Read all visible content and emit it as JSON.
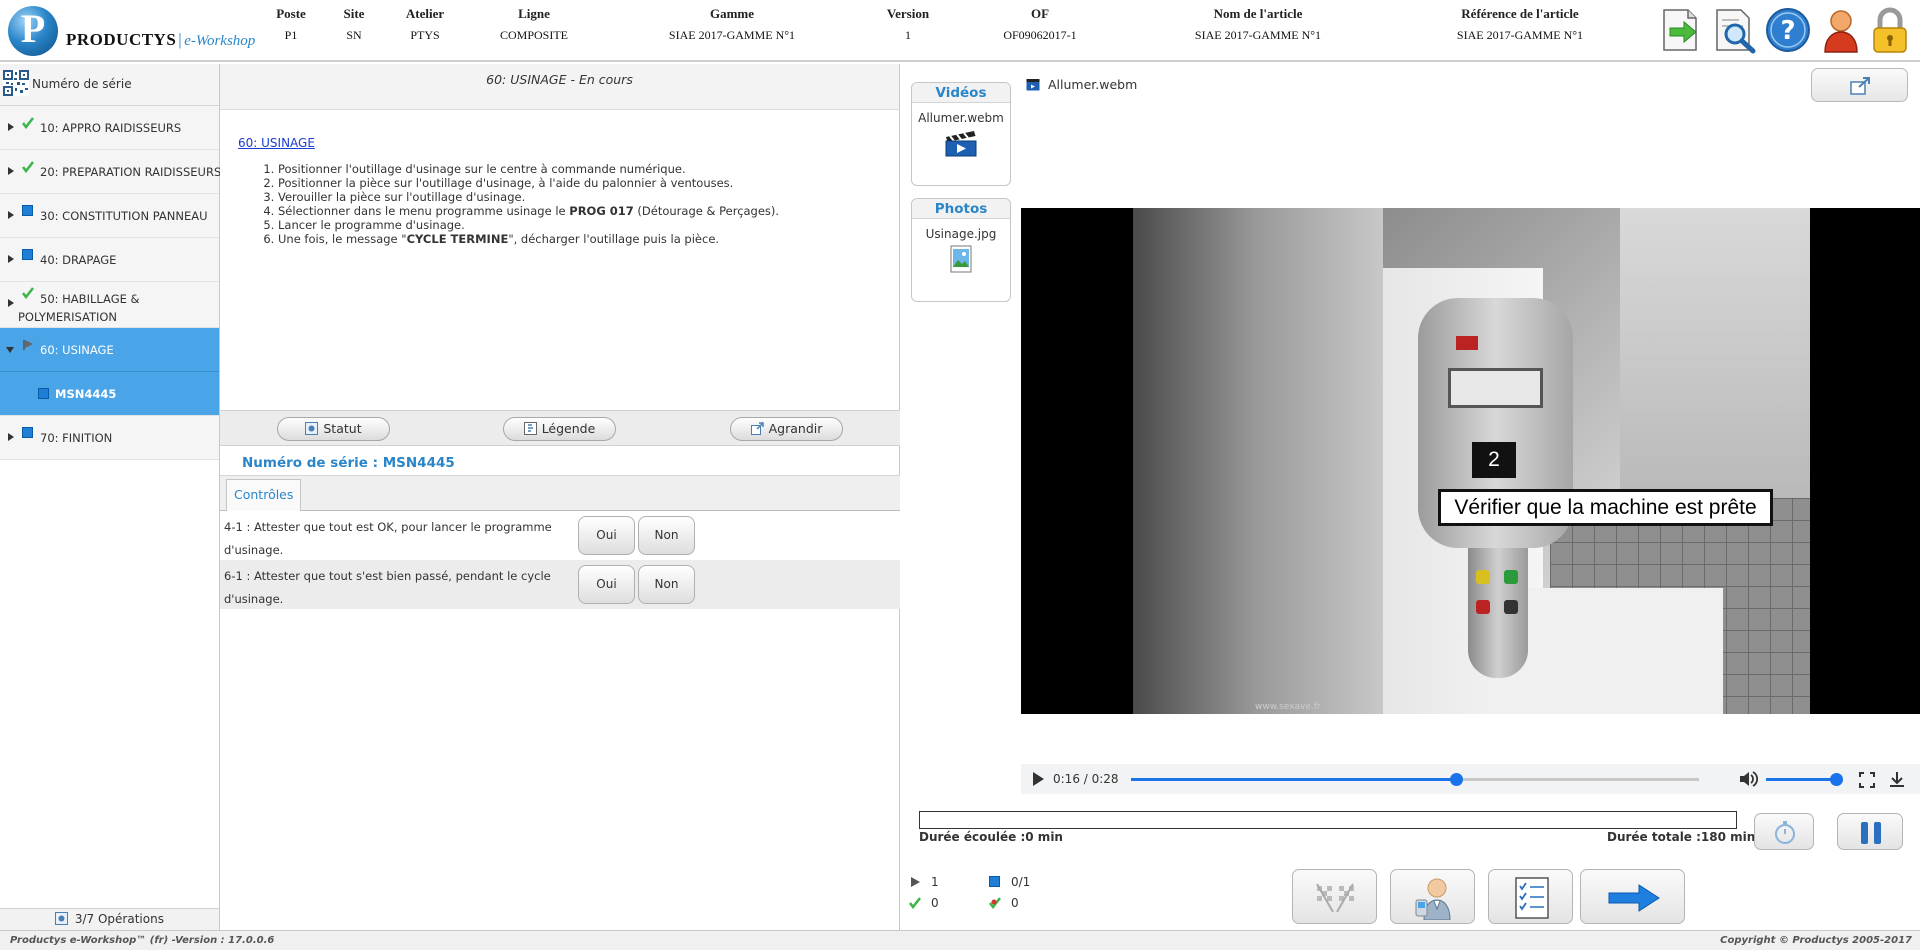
{
  "app": {
    "logo_letter": "P",
    "logo_name": "PRODUCTYS",
    "logo_separator": "|",
    "logo_sub": "e-Workshop"
  },
  "header": {
    "columns": [
      {
        "label": "Poste",
        "value": "P1"
      },
      {
        "label": "Site",
        "value": "SN"
      },
      {
        "label": "Atelier",
        "value": "PTYS"
      },
      {
        "label": "Ligne",
        "value": "COMPOSITE"
      },
      {
        "label": "Gamme",
        "value": "SIAE 2017-GAMME N°1"
      },
      {
        "label": "Version",
        "value": "1"
      },
      {
        "label": "OF",
        "value": "OF09062017-1"
      },
      {
        "label": "Nom de l'article",
        "value": "SIAE 2017-GAMME N°1"
      },
      {
        "label": "Référence de l'article",
        "value": "SIAE 2017-GAMME N°1"
      }
    ],
    "tools": [
      {
        "icon": "export-icon"
      },
      {
        "icon": "search-document-icon"
      },
      {
        "icon": "help-icon"
      },
      {
        "icon": "user-icon"
      },
      {
        "icon": "lock-icon"
      }
    ]
  },
  "sidebar": {
    "serial_label": "Numéro de série",
    "operations": [
      {
        "label": "10: APPRO RAIDISSEURS",
        "status": "done"
      },
      {
        "label": "20: PREPARATION RAIDISSEURS",
        "status": "done"
      },
      {
        "label": "30: CONSTITUTION PANNEAU",
        "status": "todo"
      },
      {
        "label": "40: DRAPAGE",
        "status": "todo"
      },
      {
        "label": "50: HABILLAGE &",
        "label2": "POLYMERISATION",
        "status": "done"
      },
      {
        "label": "60: USINAGE",
        "status": "running"
      },
      {
        "label": "MSN4445",
        "status": "todo"
      },
      {
        "label": "70: FINITION",
        "status": "todo"
      }
    ],
    "footer": "3/7 Opérations"
  },
  "center": {
    "title": "60: USINAGE - En cours",
    "instructions_heading": "60: USINAGE",
    "steps": [
      {
        "text": "Positionner l'outillage d'usinage sur le centre à commande numérique."
      },
      {
        "text": "Positionner la pièce sur l'outillage d'usinage, à l'aide du palonnier à ventouses."
      },
      {
        "text": "Verouiller la pièce sur l'outillage d'usinage."
      },
      {
        "pre": "Sélectionner dans le menu programme usinage le ",
        "bold": "PROG 017",
        "post": " (Détourage & Perçages)."
      },
      {
        "text": "Lancer le programme d'usinage."
      },
      {
        "pre": "Une fois, le message \"",
        "bold": "CYCLE TERMINE",
        "post": "\", décharger l'outillage puis la pièce."
      }
    ],
    "buttons": {
      "statut": "Statut",
      "legende": "Légende",
      "agrandir": "Agrandir"
    },
    "serial_title": "Numéro de série : MSN4445",
    "tab_controls": "Contrôles",
    "controls": [
      {
        "text": "4-1 : Attester que tout est OK, pour lancer le programme d'usinage.",
        "yes": "Oui",
        "no": "Non"
      },
      {
        "text": "6-1 : Attester que tout s'est bien passé, pendant le cycle d'usinage.",
        "yes": "Oui",
        "no": "Non"
      }
    ]
  },
  "media": {
    "videos_title": "Vidéos",
    "video_file": "Allumer.webm",
    "photos_title": "Photos",
    "photo_file": "Usinage.jpg",
    "current_file": "Allumer.webm",
    "overlay_number": "2",
    "overlay_caption": "Vérifier que la machine est prête",
    "watermark": "www.sexave.fr",
    "player": {
      "time": "0:16 / 0:28",
      "progress": 0.5714,
      "volume": 1.0
    }
  },
  "timing": {
    "elapsed": "Durée écoulée :0 min",
    "total": "Durée totale :180 min"
  },
  "counters": {
    "running": "1",
    "done": "0",
    "todo": "0/1",
    "mixed": "0"
  },
  "colors": {
    "accent": "#2a86c9",
    "selected": "#4aa4e8",
    "done_check": "#39b54a",
    "todo_square": "#1f7fd6"
  },
  "footer": {
    "left": "Productys e-Workshop™ (fr) -Version : 17.0.0.6",
    "right": "Copyright © Productys 2005-2017"
  }
}
